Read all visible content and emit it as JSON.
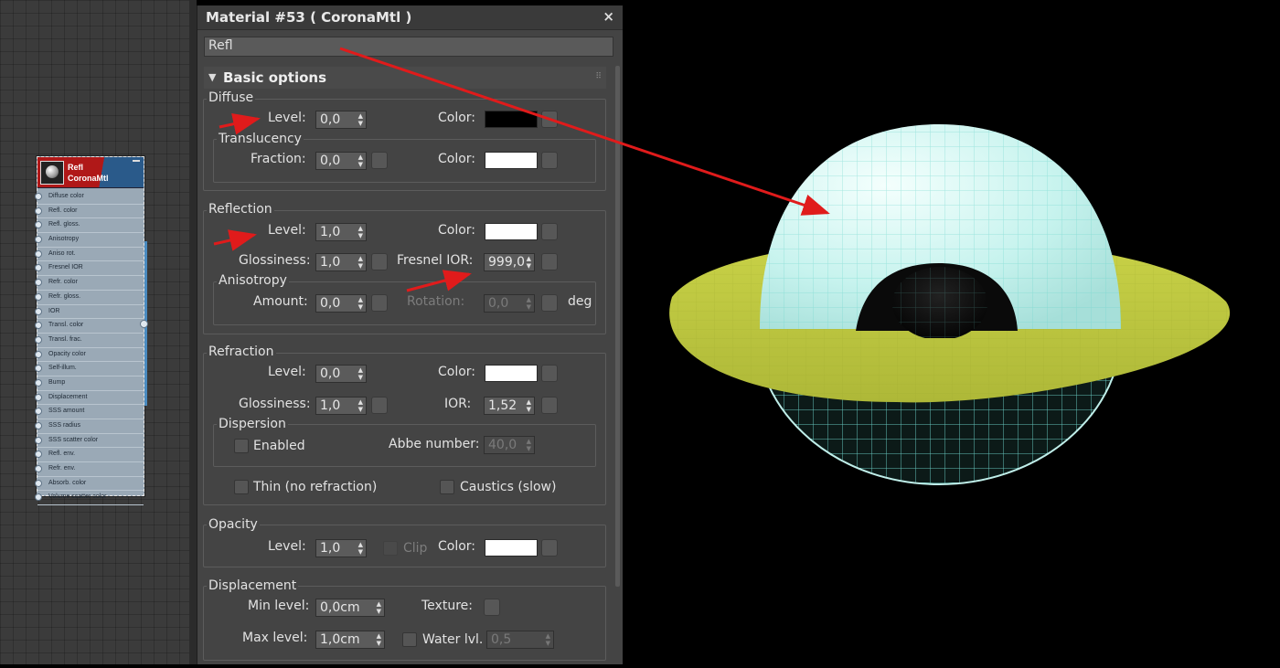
{
  "node": {
    "title_line1": "Refl",
    "title_line2": "CoronaMtl",
    "slots": [
      "Diffuse color",
      "Refl. color",
      "Refl. gloss.",
      "Anisotropy",
      "Aniso rot.",
      "Fresnel IOR",
      "Refr. color",
      "Refr. gloss.",
      "IOR",
      "Transl. color",
      "Transl. frac.",
      "Opacity color",
      "Self-illum.",
      "Bump",
      "Displacement",
      "SSS amount",
      "SSS radius",
      "SSS scatter color",
      "Refl. env.",
      "Refr. env.",
      "Absorb. color",
      "Volume scatter color"
    ]
  },
  "panel": {
    "title": "Material #53  ( CoronaMtl )",
    "close": "×",
    "name": "Refl",
    "rollout_title": "Basic options",
    "diffuse": {
      "group": "Diffuse",
      "level_label": "Level:",
      "level": "0,0",
      "color_label": "Color:",
      "color": "#000000",
      "translucency": {
        "group": "Translucency",
        "fraction_label": "Fraction:",
        "fraction": "0,0",
        "color_label": "Color:",
        "color": "#ffffff"
      }
    },
    "reflection": {
      "group": "Reflection",
      "level_label": "Level:",
      "level": "1,0",
      "color_label": "Color:",
      "color": "#ffffff",
      "gloss_label": "Glossiness:",
      "gloss": "1,0",
      "fresnel_label": "Fresnel IOR:",
      "fresnel": "999,0",
      "anisotropy": {
        "group": "Anisotropy",
        "amount_label": "Amount:",
        "amount": "0,0",
        "rotation_label": "Rotation:",
        "rotation": "0,0",
        "unit": "deg"
      }
    },
    "refraction": {
      "group": "Refraction",
      "level_label": "Level:",
      "level": "0,0",
      "color_label": "Color:",
      "color": "#ffffff",
      "gloss_label": "Glossiness:",
      "gloss": "1,0",
      "ior_label": "IOR:",
      "ior": "1,52",
      "dispersion": {
        "group": "Dispersion",
        "enabled_label": "Enabled",
        "abbe_label": "Abbe number:",
        "abbe": "40,0"
      },
      "thin_label": "Thin (no refraction)",
      "caustics_label": "Caustics (slow)"
    },
    "opacity": {
      "group": "Opacity",
      "level_label": "Level:",
      "level": "1,0",
      "clip_label": "Clip",
      "color_label": "Color:",
      "color": "#ffffff"
    },
    "displacement": {
      "group": "Displacement",
      "min_label": "Min level:",
      "min": "0,0cm",
      "texture_label": "Texture:",
      "max_label": "Max level:",
      "max": "1,0cm",
      "water_label": "Water lvl.",
      "water": "0,5"
    }
  },
  "colors": {
    "arrow": "#e01b1b",
    "sphere": "#c7f3ee",
    "wire": "#6fd6cc",
    "disc": "#c8d34a"
  }
}
